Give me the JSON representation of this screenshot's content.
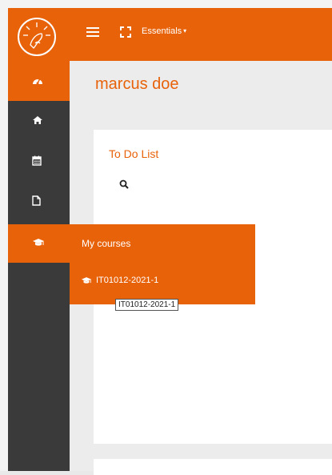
{
  "header": {
    "dropdown_label": "Essentials",
    "caret": "▾",
    "brand_color": "#e8620a"
  },
  "icons": {
    "nav_toggle": "hamburger-icon",
    "fullscreen": "expand-icon",
    "sidebar": [
      "dashboard-icon",
      "home-icon",
      "calendar-icon",
      "file-icon",
      "graduation-cap-icon"
    ]
  },
  "page": {
    "title": "marcus doe"
  },
  "todo": {
    "title": "To Do List"
  },
  "flyout": {
    "title": "My courses",
    "course": "IT01012-2021-1"
  },
  "tooltip": {
    "text": "IT01012-2021-1"
  }
}
